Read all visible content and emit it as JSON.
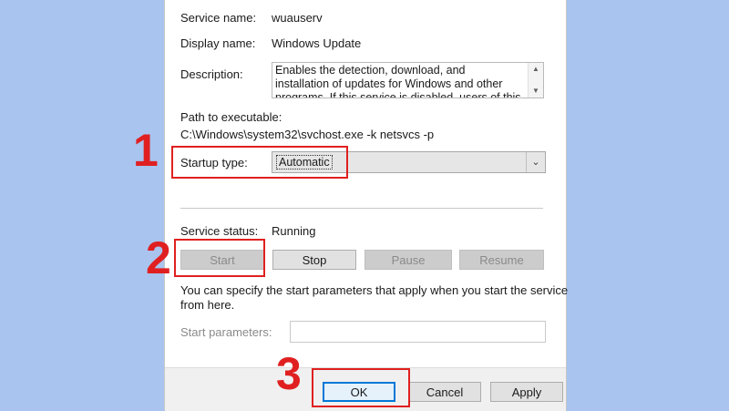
{
  "dialog": {
    "service_name_label": "Service name:",
    "service_name_value": "wuauserv",
    "display_name_label": "Display name:",
    "display_name_value": "Windows Update",
    "description_label": "Description:",
    "description_value": "Enables the detection, download, and installation of updates for Windows and other programs. If this service is disabled, users of this computer will not be",
    "path_label": "Path to executable:",
    "path_value": "C:\\Windows\\system32\\svchost.exe -k netsvcs -p",
    "startup_type_label": "Startup type:",
    "startup_type_value": "Automatic",
    "service_status_label": "Service status:",
    "service_status_value": "Running",
    "buttons": {
      "start": "Start",
      "stop": "Stop",
      "pause": "Pause",
      "resume": "Resume"
    },
    "hint_text_line1": "You can specify the start parameters that apply when you start the service",
    "hint_text_line2": "from here.",
    "start_parameters_label": "Start parameters:",
    "start_parameters_value": "",
    "footer": {
      "ok": "OK",
      "cancel": "Cancel",
      "apply": "Apply"
    }
  },
  "annotations": {
    "step1": "1",
    "step2": "2",
    "step3": "3",
    "color": "#e02020"
  },
  "colors": {
    "background": "#a8c4ef",
    "accent": "#0078d7"
  }
}
